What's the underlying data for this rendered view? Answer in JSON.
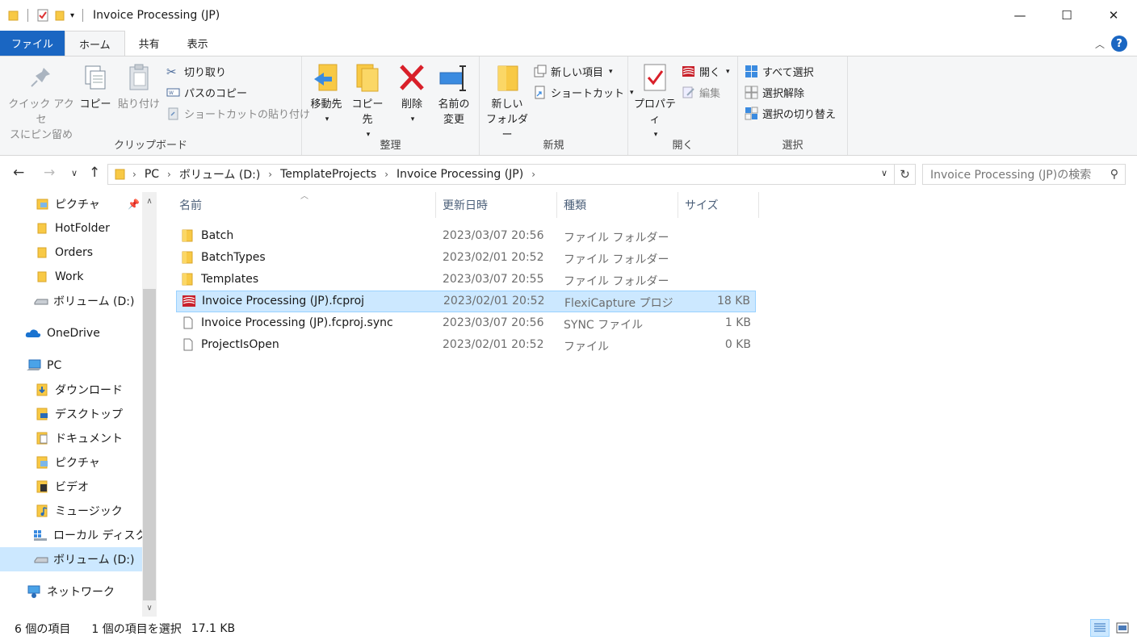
{
  "window": {
    "title": "Invoice Processing (JP)",
    "minimize": "—",
    "maximize": "☐",
    "close": "✕"
  },
  "tabs": [
    "ファイル",
    "ホーム",
    "共有",
    "表示"
  ],
  "ribbon": {
    "clipboard": {
      "label": "クリップボード",
      "pin_line1": "クイック アクセ",
      "pin_line2": "スにピン留め",
      "copy": "コピー",
      "paste": "貼り付け",
      "cut": "切り取り",
      "copy_path": "パスのコピー",
      "paste_shortcut": "ショートカットの貼り付け"
    },
    "organize": {
      "label": "整理",
      "move_to": "移動先",
      "copy_to": "コピー先",
      "delete": "削除",
      "rename_line1": "名前の",
      "rename_line2": "変更"
    },
    "new": {
      "label": "新規",
      "new_folder_line1": "新しい",
      "new_folder_line2": "フォルダー",
      "new_item": "新しい項目",
      "shortcut": "ショートカット"
    },
    "open": {
      "label": "開く",
      "properties": "プロパティ",
      "open": "開く",
      "edit": "編集"
    },
    "select": {
      "label": "選択",
      "select_all": "すべて選択",
      "select_none": "選択解除",
      "invert": "選択の切り替え"
    }
  },
  "address": {
    "crumbs": [
      "PC",
      "ボリューム (D:)",
      "TemplateProjects",
      "Invoice Processing (JP)"
    ],
    "search_placeholder": "Invoice Processing (JP)の検索"
  },
  "nav": {
    "items": [
      {
        "label": "ピクチャ",
        "icon": "pictures-icon"
      },
      {
        "label": "HotFolder",
        "icon": "folder-icon"
      },
      {
        "label": "Orders",
        "icon": "folder-icon"
      },
      {
        "label": "Work",
        "icon": "folder-icon"
      },
      {
        "label": "ボリューム (D:)",
        "icon": "drive-icon"
      },
      {
        "label": "OneDrive",
        "icon": "cloud-icon"
      },
      {
        "label": "PC",
        "icon": "pc-icon"
      },
      {
        "label": "ダウンロード",
        "icon": "downloads-icon"
      },
      {
        "label": "デスクトップ",
        "icon": "desktop-icon"
      },
      {
        "label": "ドキュメント",
        "icon": "documents-icon"
      },
      {
        "label": "ピクチャ",
        "icon": "pictures-icon"
      },
      {
        "label": "ビデオ",
        "icon": "videos-icon"
      },
      {
        "label": "ミュージック",
        "icon": "music-icon"
      },
      {
        "label": "ローカル ディスク (C:)",
        "icon": "windows-drive-icon"
      },
      {
        "label": "ボリューム (D:)",
        "icon": "drive-icon"
      },
      {
        "label": "ネットワーク",
        "icon": "network-icon"
      }
    ]
  },
  "columns": {
    "name": "名前",
    "date": "更新日時",
    "type": "種類",
    "size": "サイズ"
  },
  "files": [
    {
      "name": "Batch",
      "date": "2023/03/07 20:56",
      "type": "ファイル フォルダー",
      "size": ""
    },
    {
      "name": "BatchTypes",
      "date": "2023/02/01 20:52",
      "type": "ファイル フォルダー",
      "size": ""
    },
    {
      "name": "Templates",
      "date": "2023/03/07 20:55",
      "type": "ファイル フォルダー",
      "size": ""
    },
    {
      "name": "Invoice Processing (JP).fcproj",
      "date": "2023/02/01 20:52",
      "type": "FlexiCapture プロジ...",
      "size": "18 KB"
    },
    {
      "name": "Invoice Processing (JP).fcproj.sync",
      "date": "2023/03/07 20:56",
      "type": "SYNC ファイル",
      "size": "1 KB"
    },
    {
      "name": "ProjectIsOpen",
      "date": "2023/02/01 20:52",
      "type": "ファイル",
      "size": "0 KB"
    }
  ],
  "status": {
    "count": "6 個の項目",
    "selected": "1 個の項目を選択",
    "size": "17.1 KB"
  },
  "colors": {
    "accent": "#1a66c2",
    "selection": "#cce8ff",
    "folder": "#f8c945"
  }
}
